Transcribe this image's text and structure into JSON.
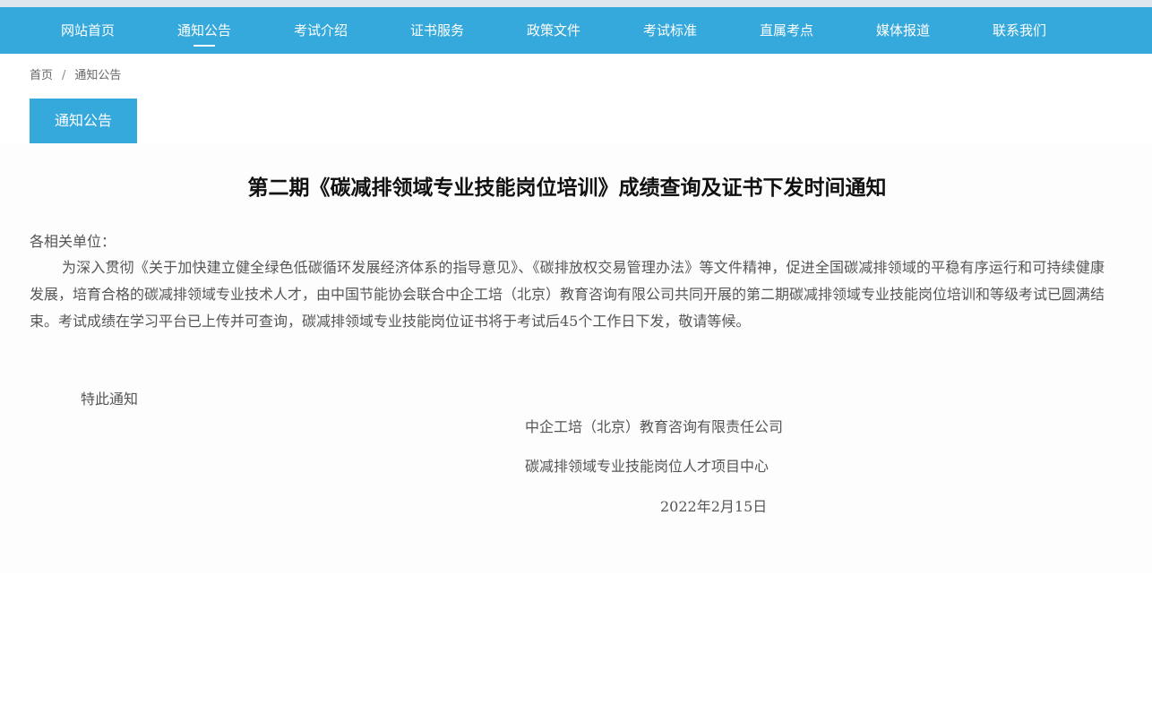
{
  "nav": {
    "items": [
      {
        "label": "网站首页",
        "active": false
      },
      {
        "label": "通知公告",
        "active": true
      },
      {
        "label": "考试介绍",
        "active": false
      },
      {
        "label": "证书服务",
        "active": false
      },
      {
        "label": "政策文件",
        "active": false
      },
      {
        "label": "考试标准",
        "active": false
      },
      {
        "label": "直属考点",
        "active": false
      },
      {
        "label": "媒体报道",
        "active": false
      },
      {
        "label": "联系我们",
        "active": false
      }
    ]
  },
  "breadcrumb": {
    "home": "首页",
    "separator": "/",
    "current": "通知公告"
  },
  "section": {
    "label": "通知公告"
  },
  "article": {
    "title": "第二期《碳减排领域专业技能岗位培训》成绩查询及证书下发时间通知",
    "salutation": "各相关单位：",
    "paragraph": "为深入贯彻《关于加快建立健全绿色低碳循环发展经济体系的指导意见》、《碳排放权交易管理办法》等文件精神，促进全国碳减排领域的平稳有序运行和可持续健康发展，培育合格的碳减排领域专业技术人才，由中国节能协会联合中企工培（北京）教育咨询有限公司共同开展的第二期碳减排领域专业技能岗位培训和等级考试已圆满结束。考试成绩在学习平台已上传并可查询，碳减排领域专业技能岗位证书将于考试后45个工作日下发，敬请等候。",
    "signoff": "特此通知",
    "org1": "中企工培（北京）教育咨询有限责任公司",
    "org2": "碳减排领域专业技能岗位人才项目中心",
    "date": "2022年2月15日"
  },
  "colors": {
    "accent": "#36a9dc",
    "nav_text": "#ffffff",
    "body_text": "#555555"
  }
}
